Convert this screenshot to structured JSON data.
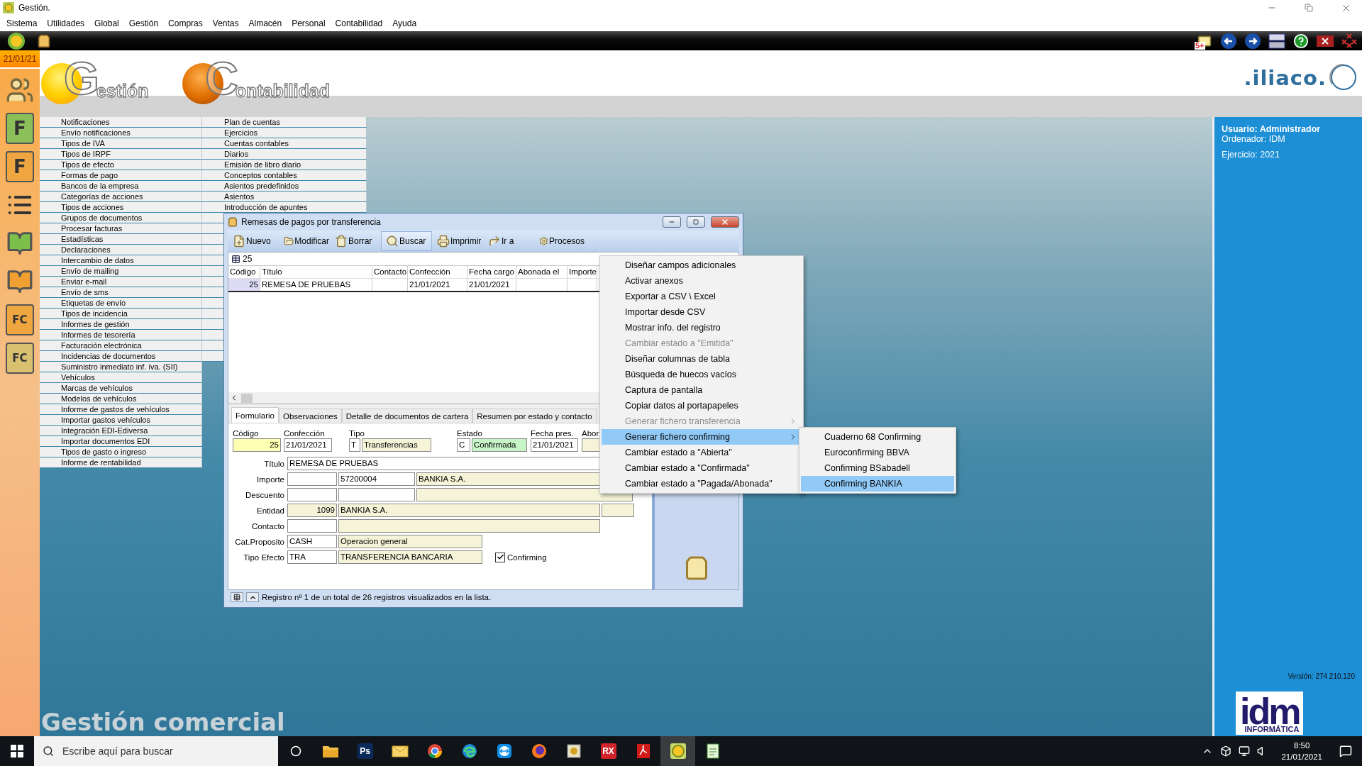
{
  "window": {
    "title": "Gestión.",
    "menu": [
      "Sistema",
      "Utilidades",
      "Global",
      "Gestión",
      "Compras",
      "Ventas",
      "Almacén",
      "Personal",
      "Contabilidad",
      "Ayuda"
    ]
  },
  "toolbar": {
    "mail_badge": "5+"
  },
  "date": "21/01/21",
  "side_tools": [
    {
      "kind": "people"
    },
    {
      "kind": "tile",
      "label": "F",
      "color": "#8bbf5a"
    },
    {
      "kind": "tile",
      "label": "F",
      "color": "#f0a640"
    },
    {
      "kind": "ledger"
    },
    {
      "kind": "book",
      "color": "#7cc04a"
    },
    {
      "kind": "book",
      "color": "#f0a030"
    },
    {
      "kind": "tile",
      "label": "FC",
      "color": "#f0a640"
    },
    {
      "kind": "tile",
      "label": "FC",
      "color": "#d8c070"
    }
  ],
  "logos": {
    "gestion": "Gestión",
    "contabilidad": "Contabilidad",
    "brand": ".iliaco."
  },
  "menu_columns": [
    [
      "Notificaciones",
      "Envío notificaciones",
      "Tipos de IVA",
      "Tipos de IRPF",
      "Tipos de efecto",
      "Formas de pago",
      "Bancos de la empresa",
      "Categorías de acciones",
      "Tipos de acciones",
      "Grupos de documentos",
      "Procesar facturas",
      "Estadísticas",
      "Declaraciones",
      "Intercambio de datos",
      "Envío de mailing",
      "Enviar e-mail",
      "Envío de sms",
      "Etiquetas de envío",
      "Tipos de incidencia",
      "Informes de gestión",
      "Informes de tesorería",
      "Facturación electrónica",
      "Incidencias de documentos",
      "Suministro inmediato inf. iva. (SII)",
      "Vehículos",
      "Marcas de vehículos",
      "Modelos de vehículos",
      "Informe de gastos de vehículos",
      "Importar gastos vehículos",
      "Integración EDI-Ediversa",
      "Importar documentos EDI",
      "Tipos de gasto o ingreso",
      "Informe de rentabilidad"
    ],
    [
      "Plan de cuentas",
      "Ejercicios",
      "Cuentas contables",
      "Diarios",
      "Emisión de libro diario",
      "Conceptos contables",
      "Asientos predefinidos",
      "Asientos",
      "Introducción de apuntes"
    ]
  ],
  "info": {
    "user": "Usuario: Administrador",
    "computer": "Ordenador: IDM",
    "year": "Ejercicio: 2021",
    "version": "Versión: 274 210.120",
    "company": "idm",
    "company_sub": "INFORMÁTICA"
  },
  "footer_title": "Gestión comercial",
  "dialog": {
    "title": "Remesas de pagos por transferencia",
    "buttons": [
      {
        "kind": "new",
        "label": "Nuevo",
        "selected": false
      },
      {
        "kind": "edit",
        "label": "Modificar",
        "selected": false
      },
      {
        "kind": "delete",
        "label": "Borrar",
        "selected": false
      },
      {
        "kind": "search",
        "label": "Buscar",
        "selected": true
      },
      {
        "kind": "print",
        "label": "Imprimir",
        "selected": false
      },
      {
        "kind": "goto",
        "label": "Ir a",
        "selected": false
      },
      {
        "kind": "process",
        "label": "Procesos",
        "selected": false
      }
    ],
    "record": "25",
    "columns": [
      "Código",
      "Título",
      "Contacto",
      "Confección",
      "Fecha cargo",
      "Abonada el",
      "Importe"
    ],
    "rows": [
      {
        "selected": true,
        "cells": [
          "25",
          "REMESA DE PRUEBAS",
          null,
          "21/01/2021",
          "21/01/2021",
          null,
          null
        ]
      }
    ],
    "tabs": [
      {
        "label": "Formulario",
        "selected": true
      },
      {
        "label": "Observaciones",
        "selected": false
      },
      {
        "label": "Detalle de documentos de cartera",
        "selected": false
      },
      {
        "label": "Resumen por estado y contacto",
        "selected": false
      }
    ],
    "top_fields": [
      {
        "label": "Código",
        "parts": [
          {
            "kind": "key",
            "value": "25"
          }
        ]
      },
      {
        "label": "Confección",
        "parts": [
          {
            "kind": "plain",
            "value": "21/01/2021"
          }
        ]
      },
      {
        "label": "Tipo",
        "parts": [
          {
            "kind": "plain",
            "value": "T"
          },
          {
            "kind": "lookup",
            "value": "Transferencias"
          }
        ]
      },
      {
        "label": "Estado",
        "parts": [
          {
            "kind": "plain",
            "value": "C"
          },
          {
            "kind": "status",
            "value": "Confirmada"
          }
        ]
      },
      {
        "label": "Fecha pres.",
        "parts": [
          {
            "kind": "plain",
            "value": "21/01/2021"
          }
        ]
      },
      {
        "label": "Abor",
        "parts": [
          {
            "kind": "lookup"
          }
        ]
      }
    ],
    "fields": [
      {
        "label": "Título",
        "parts": [
          {
            "kind": "plain",
            "value": "REMESA DE PRUEBAS"
          }
        ]
      },
      {
        "label": "Importe",
        "parts": [
          {
            "kind": "plain"
          },
          {
            "kind": "plain",
            "value": "57200004"
          },
          {
            "kind": "lookup",
            "value": "BANKIA S.A."
          }
        ]
      },
      {
        "label": "Descuento",
        "parts": [
          {
            "kind": "plain"
          },
          {
            "kind": "plain"
          },
          {
            "kind": "lookup"
          }
        ]
      },
      {
        "label": "Entidad",
        "parts": [
          {
            "kind": "number",
            "value": "1099"
          },
          {
            "kind": "lookup",
            "value": "BANKIA S.A."
          },
          {
            "kind": "lookup"
          }
        ]
      },
      {
        "label": "Contacto",
        "parts": [
          {
            "kind": "plain"
          },
          {
            "kind": "lookup"
          }
        ]
      },
      {
        "label": "Cat.Proposito",
        "parts": [
          {
            "kind": "plain",
            "value": "CASH"
          },
          {
            "kind": "lookup",
            "value": "Operacion general"
          }
        ]
      },
      {
        "label": "Tipo Efecto",
        "parts": [
          {
            "kind": "plain",
            "value": "TRA"
          },
          {
            "kind": "lookup",
            "value": "TRANSFERENCIA BANCARIA"
          }
        ]
      }
    ],
    "checkbox": {
      "label": "Confirming",
      "checked": true
    },
    "status": "Registro nº 1 de un total de 26 registros visualizados en la lista."
  },
  "context_menu": {
    "items": [
      {
        "label": "Diseñar campos adicionales",
        "disabled": false,
        "submenu": false,
        "selected": false
      },
      {
        "label": "Activar anexos",
        "disabled": false,
        "submenu": false,
        "selected": false
      },
      {
        "label": "Exportar a CSV \\ Excel",
        "disabled": false,
        "submenu": false,
        "selected": false
      },
      {
        "label": "Importar desde CSV",
        "disabled": false,
        "submenu": false,
        "selected": false
      },
      {
        "label": "Mostrar info. del registro",
        "disabled": false,
        "submenu": false,
        "selected": false
      },
      {
        "label": "Cambiar estado a \"Emitida\"",
        "disabled": true,
        "submenu": false,
        "selected": false
      },
      {
        "label": "Diseñar columnas de tabla",
        "disabled": false,
        "submenu": false,
        "selected": false
      },
      {
        "label": "Búsqueda de huecos vacíos",
        "disabled": false,
        "submenu": false,
        "selected": false
      },
      {
        "label": "Captura de pantalla",
        "disabled": false,
        "submenu": false,
        "selected": false
      },
      {
        "label": "Copiar datos al portapapeles",
        "disabled": false,
        "submenu": false,
        "selected": false
      },
      {
        "label": "Generar fichero transferencia",
        "disabled": true,
        "submenu": true,
        "selected": false
      },
      {
        "label": "Generar fichero confirming",
        "disabled": false,
        "submenu": true,
        "selected": true
      },
      {
        "label": "Cambiar estado a \"Abierta\"",
        "disabled": false,
        "submenu": false,
        "selected": false
      },
      {
        "label": "Cambiar estado a \"Confirmada\"",
        "disabled": false,
        "submenu": false,
        "selected": false
      },
      {
        "label": "Cambiar estado a \"Pagada/Abonada\"",
        "disabled": false,
        "submenu": false,
        "selected": false
      }
    ],
    "submenu": [
      {
        "label": "Cuaderno 68 Confirming",
        "selected": false
      },
      {
        "label": "Euroconfirming BBVA",
        "selected": false
      },
      {
        "label": "Confirming BSabadell",
        "selected": false
      },
      {
        "label": "Confirming BANKIA",
        "selected": true
      }
    ]
  },
  "taskbar": {
    "search_placeholder": "Escribe aquí para buscar",
    "apps": [
      {
        "kind": "folder",
        "selected": false
      },
      {
        "kind": "label",
        "label": "Ps",
        "color": "#0b2a5a",
        "selected": false
      },
      {
        "kind": "envelope",
        "selected": false
      },
      {
        "kind": "chrome",
        "selected": false
      },
      {
        "kind": "edge",
        "selected": false
      },
      {
        "kind": "teamviewer",
        "selected": false
      },
      {
        "kind": "firefox",
        "selected": false
      },
      {
        "kind": "app",
        "selected": false
      },
      {
        "kind": "label",
        "label": "RX",
        "color": "#d0242a",
        "selected": false
      },
      {
        "kind": "pdf",
        "selected": false
      },
      {
        "kind": "gestion",
        "selected": true
      },
      {
        "kind": "sheet",
        "selected": false
      }
    ],
    "time": "8:50",
    "date": "21/01/2021"
  }
}
